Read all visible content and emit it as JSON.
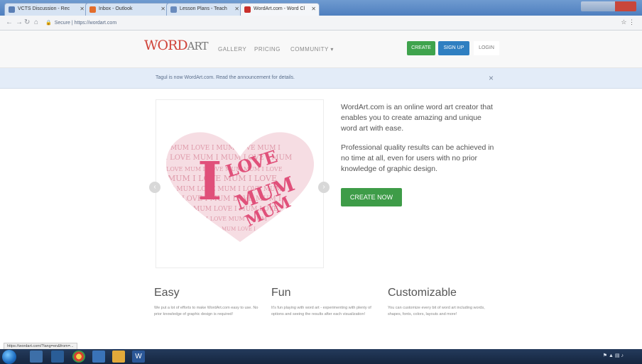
{
  "browser": {
    "tabs": [
      {
        "label": "VCTS Discussion - Rec"
      },
      {
        "label": "Inbox - Outlook"
      },
      {
        "label": "Lesson Plans - Teach"
      },
      {
        "label": "WordArt.com - Word Cl",
        "active": true
      }
    ],
    "url": "https://wordart.com",
    "secure_label": "Secure"
  },
  "site": {
    "logo_word": "WORD",
    "logo_art": "ART",
    "nav": [
      "GALLERY",
      "PRICING",
      "COMMUNITY ▾"
    ],
    "create_label": "CREATE",
    "signup_label": "SIGN UP",
    "login_label": "LOGIN"
  },
  "announcement": {
    "text": "Tagul is now WordArt.com. Read the announcement for details.",
    "close": "×"
  },
  "hero": {
    "carousel_prev": "‹",
    "carousel_next": "›",
    "paragraph1": "WordArt.com is an online word art creator that enables you to create amazing and unique word art with ease.",
    "paragraph2": "Professional quality results can be achieved in no time at all, even for users with no prior knowledge of graphic design.",
    "cta": "CREATE NOW",
    "art": {
      "words": [
        "I",
        "LOVE",
        "MUM",
        "MUM",
        "I",
        "LOVE",
        "MUM",
        "I",
        "MUM",
        "LOVE"
      ]
    }
  },
  "features": [
    {
      "title": "Easy",
      "desc": "We put a lot of efforts to make WordArt.com easy to use. No prior knowledge of graphic design is required!"
    },
    {
      "title": "Fun",
      "desc": "It's fun playing with word art - experimenting with plenty of options and seeing the results after each visualization!"
    },
    {
      "title": "Customizable",
      "desc": "You can customize every bit of word art including words, shapes, fonts, colors, layouts and more!"
    }
  ],
  "status_url": "https://wordart.com/?lang=en&from=..."
}
